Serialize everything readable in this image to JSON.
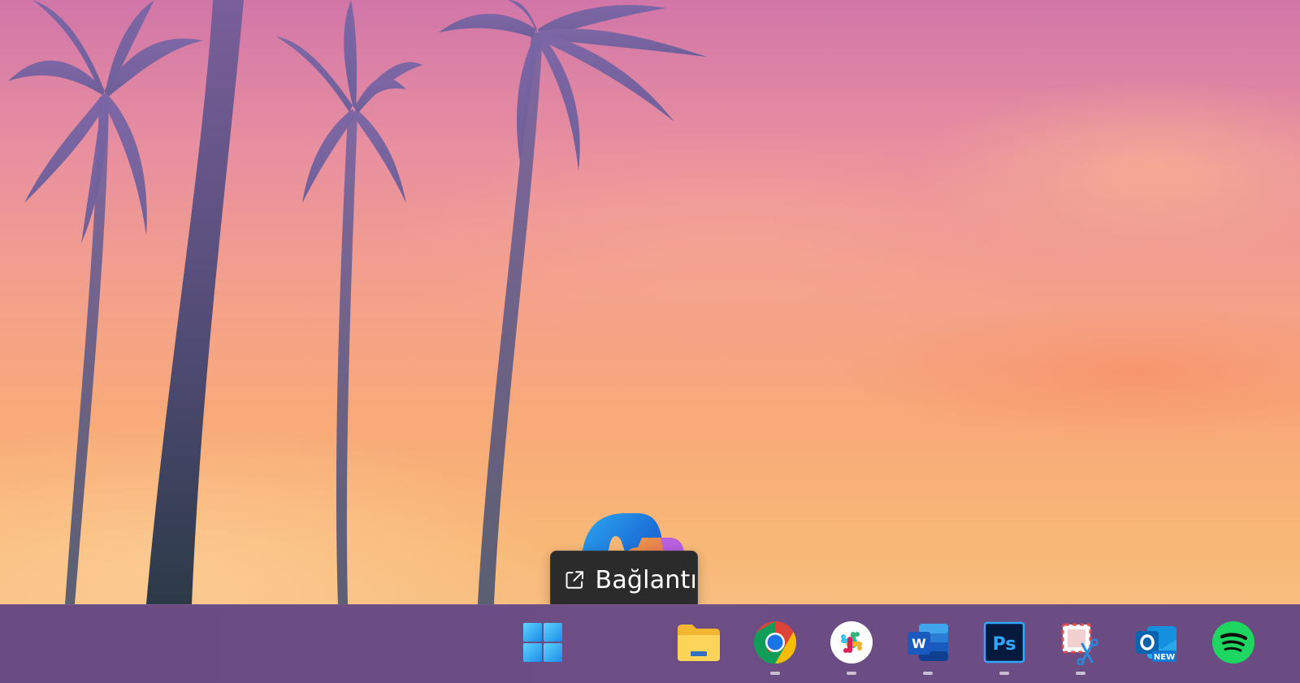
{
  "tooltip": {
    "label": "Bağlantı",
    "icon": "external-link-icon"
  },
  "taskbar": {
    "items": [
      {
        "name": "start",
        "icon": "windows-logo-icon",
        "running": false
      },
      {
        "name": "file-explorer",
        "icon": "folder-icon",
        "running": false
      },
      {
        "name": "chrome",
        "icon": "chrome-icon",
        "running": true
      },
      {
        "name": "slack",
        "icon": "slack-icon",
        "running": true
      },
      {
        "name": "word",
        "icon": "word-icon",
        "running": true,
        "badge": "W"
      },
      {
        "name": "photoshop",
        "icon": "photoshop-icon",
        "running": true,
        "badge": "Ps"
      },
      {
        "name": "snipping-tool",
        "icon": "snipping-tool-icon",
        "running": true
      },
      {
        "name": "outlook-new",
        "icon": "outlook-icon",
        "running": false,
        "badge": "O",
        "sub_badge": "NEW"
      },
      {
        "name": "spotify",
        "icon": "spotify-icon",
        "running": false
      }
    ],
    "dragged_item": {
      "name": "copilot",
      "icon": "copilot-icon"
    }
  },
  "colors": {
    "taskbar": "#6a4b82",
    "tooltip_bg": "#2b2b2b",
    "running_indicator": "#c9bfd3"
  }
}
